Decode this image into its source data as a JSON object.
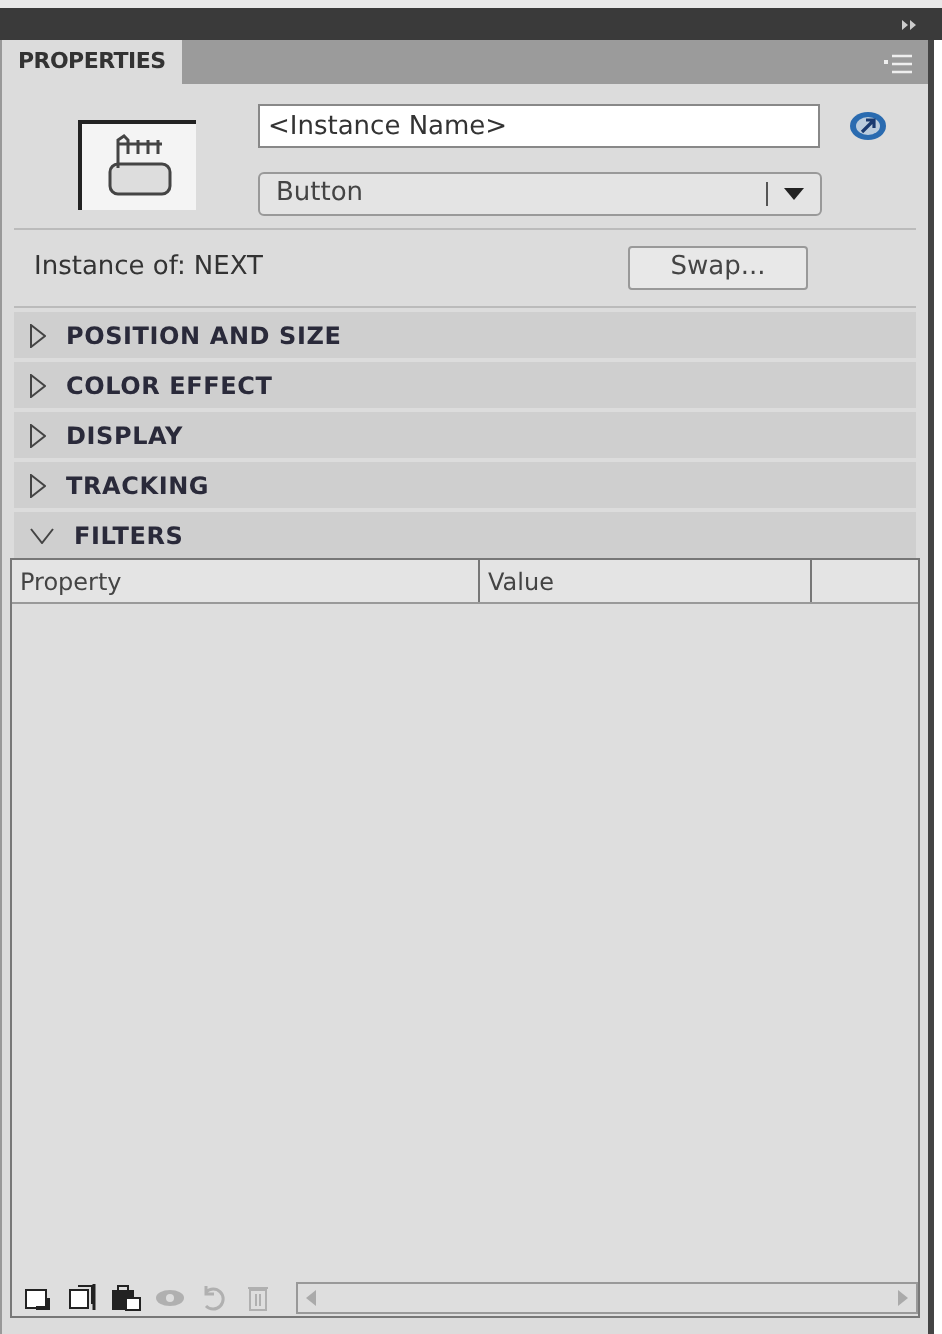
{
  "panel": {
    "tab": "PROPERTIES"
  },
  "instance": {
    "name_placeholder": "<Instance Name>",
    "type": "Button",
    "instance_of_label": "Instance of:",
    "instance_of_value": "NEXT",
    "swap_button": "Swap..."
  },
  "sections": [
    {
      "title": "POSITION AND SIZE",
      "expanded": false
    },
    {
      "title": "COLOR EFFECT",
      "expanded": false
    },
    {
      "title": "DISPLAY",
      "expanded": false
    },
    {
      "title": "TRACKING",
      "expanded": false
    },
    {
      "title": "FILTERS",
      "expanded": true
    }
  ],
  "table": {
    "columns": [
      "Property",
      "Value"
    ]
  },
  "toolbar": [
    {
      "kind": "add",
      "disabled": false
    },
    {
      "kind": "presets",
      "disabled": false
    },
    {
      "kind": "clipboard",
      "disabled": false
    },
    {
      "kind": "toggle",
      "disabled": true
    },
    {
      "kind": "reset",
      "disabled": true
    },
    {
      "kind": "delete",
      "disabled": true
    }
  ]
}
